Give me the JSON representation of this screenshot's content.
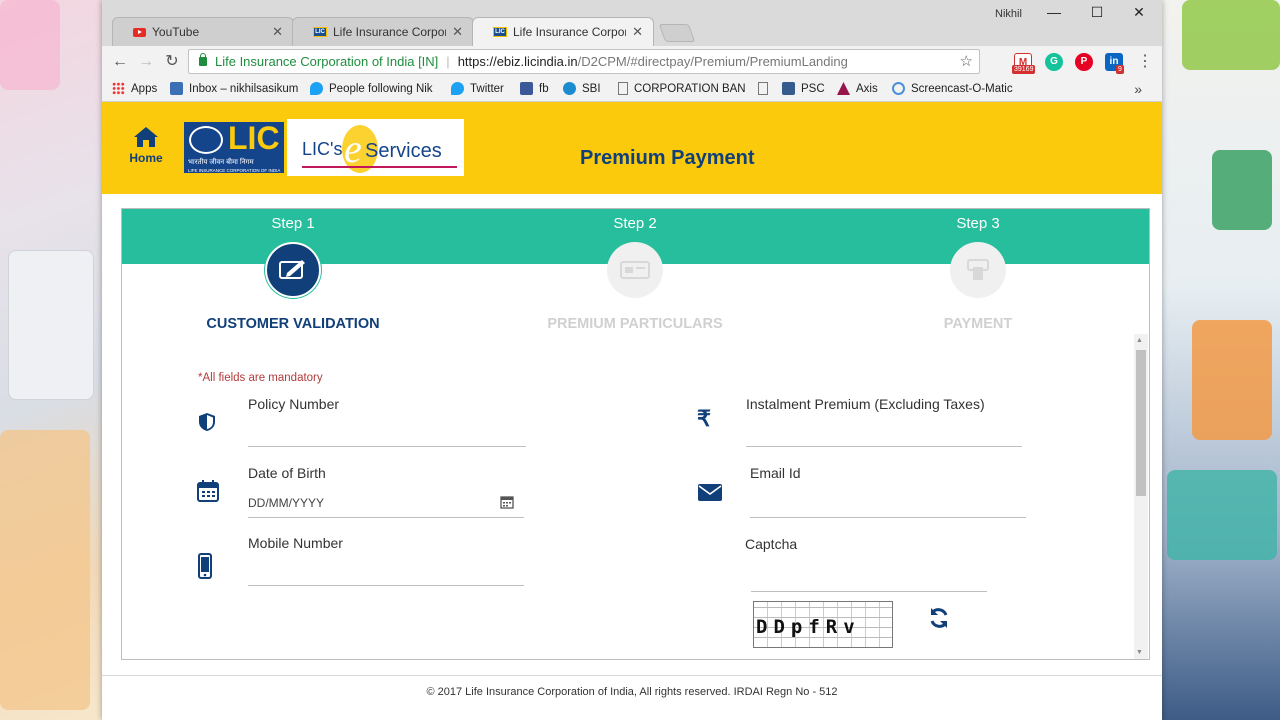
{
  "browser": {
    "tabs": [
      {
        "title": "YouTube",
        "favicon": "youtube-icon",
        "active": false
      },
      {
        "title": "Life Insurance Corporatio",
        "favicon": "lic-icon",
        "active": false
      },
      {
        "title": "Life Insurance Corporatio",
        "favicon": "lic-icon",
        "active": true
      }
    ],
    "profile_name": "Nikhil",
    "window_controls": {
      "minimize": "—",
      "maximize": "☐",
      "close": "✕"
    },
    "address_bar": {
      "site_name": "Life Insurance Corporation of India [IN]",
      "host": "https://ebiz.licindia.in",
      "path": "/D2CPM/#directpay/Premium/PremiumLanding"
    },
    "extensions": [
      {
        "name": "gmail-icon",
        "badge": "39169",
        "color": "#d32f2f",
        "glyph": "M"
      },
      {
        "name": "grammarly-icon",
        "badge": "",
        "color": "#15c39a",
        "glyph": "G"
      },
      {
        "name": "pinterest-icon",
        "badge": "",
        "color": "#e60023",
        "glyph": "P"
      },
      {
        "name": "linkedin-icon",
        "badge": "9",
        "color": "#0a66c2",
        "glyph": "in"
      }
    ],
    "bookmarks": [
      {
        "label": "Apps",
        "icon": "apps-grid-icon"
      },
      {
        "label": "Inbox – nikhilsasikum",
        "icon": "inbox-icon"
      },
      {
        "label": "People following Nik",
        "icon": "twitter-icon"
      },
      {
        "label": "Twitter",
        "icon": "twitter-icon"
      },
      {
        "label": "fb",
        "icon": "facebook-icon"
      },
      {
        "label": "SBI",
        "icon": "sbi-icon"
      },
      {
        "label": "CORPORATION BANK",
        "icon": "page-icon"
      },
      {
        "label": "",
        "icon": "page-icon"
      },
      {
        "label": "PSC",
        "icon": "psc-icon"
      },
      {
        "label": "Axis",
        "icon": "axis-icon"
      },
      {
        "label": "Screencast-O-Matic",
        "icon": "screencast-icon"
      }
    ]
  },
  "header": {
    "home_label": "Home",
    "logo": {
      "lic": "LIC",
      "hindi": "भारतीय जीवन बीमा निगम",
      "sub": "LIFE INSURANCE CORPORATION OF INDIA",
      "eservices_prefix": "LIC's",
      "eservices_e": "e",
      "eservices_suffix": "Services"
    },
    "title": "Premium Payment"
  },
  "steps": [
    {
      "label": "Step 1",
      "name": "CUSTOMER VALIDATION",
      "icon": "edit-form-icon",
      "active": true
    },
    {
      "label": "Step 2",
      "name": "PREMIUM PARTICULARS",
      "icon": "receipt-icon",
      "active": false
    },
    {
      "label": "Step 3",
      "name": "PAYMENT",
      "icon": "payment-terminal-icon",
      "active": false
    }
  ],
  "form": {
    "mandatory_note": "*All fields are mandatory",
    "policy_number": {
      "label": "Policy Number",
      "value": ""
    },
    "date_of_birth": {
      "label": "Date of Birth",
      "placeholder": "DD/MM/YYYY"
    },
    "mobile_number": {
      "label": "Mobile Number",
      "value": ""
    },
    "instalment_premium": {
      "label": "Instalment Premium (Excluding Taxes)",
      "value": ""
    },
    "email_id": {
      "label": "Email Id",
      "value": ""
    },
    "captcha": {
      "label": "Captcha",
      "image_text": "DDpfRv",
      "value": ""
    }
  },
  "footer": {
    "text": "© 2017 Life Insurance Corporation of India, All rights reserved. IRDAI Regn No - 512"
  }
}
